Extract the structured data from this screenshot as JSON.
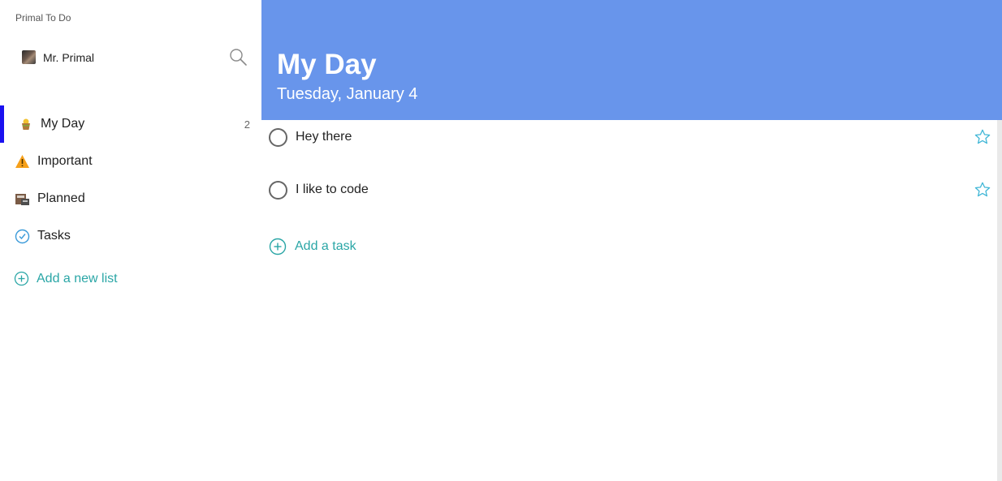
{
  "app": {
    "title": "Primal To Do"
  },
  "user": {
    "name": "Mr. Primal"
  },
  "icons": {
    "search": "search-icon",
    "my_day": "sun-basket-icon",
    "important": "warning-icon",
    "planned": "calendar-icon",
    "tasks": "clipboard-check-icon",
    "add": "plus-circle-icon",
    "star": "star-outline-icon",
    "checkbox": "circle-check-icon"
  },
  "colors": {
    "header_bg": "#6895eb",
    "accent": "#2aa6a6",
    "active_indicator": "#1a11f0"
  },
  "sidebar": {
    "items": [
      {
        "label": "My Day",
        "count": "2",
        "active": true
      },
      {
        "label": "Important",
        "count": ""
      },
      {
        "label": "Planned",
        "count": ""
      },
      {
        "label": "Tasks",
        "count": ""
      }
    ],
    "add_list_label": "Add a new list"
  },
  "main": {
    "title": "My Day",
    "date": "Tuesday, January 4",
    "tasks": [
      {
        "title": "Hey there",
        "completed": false,
        "important": false
      },
      {
        "title": "I like to code",
        "completed": false,
        "important": false
      }
    ],
    "add_task_label": "Add a task"
  }
}
